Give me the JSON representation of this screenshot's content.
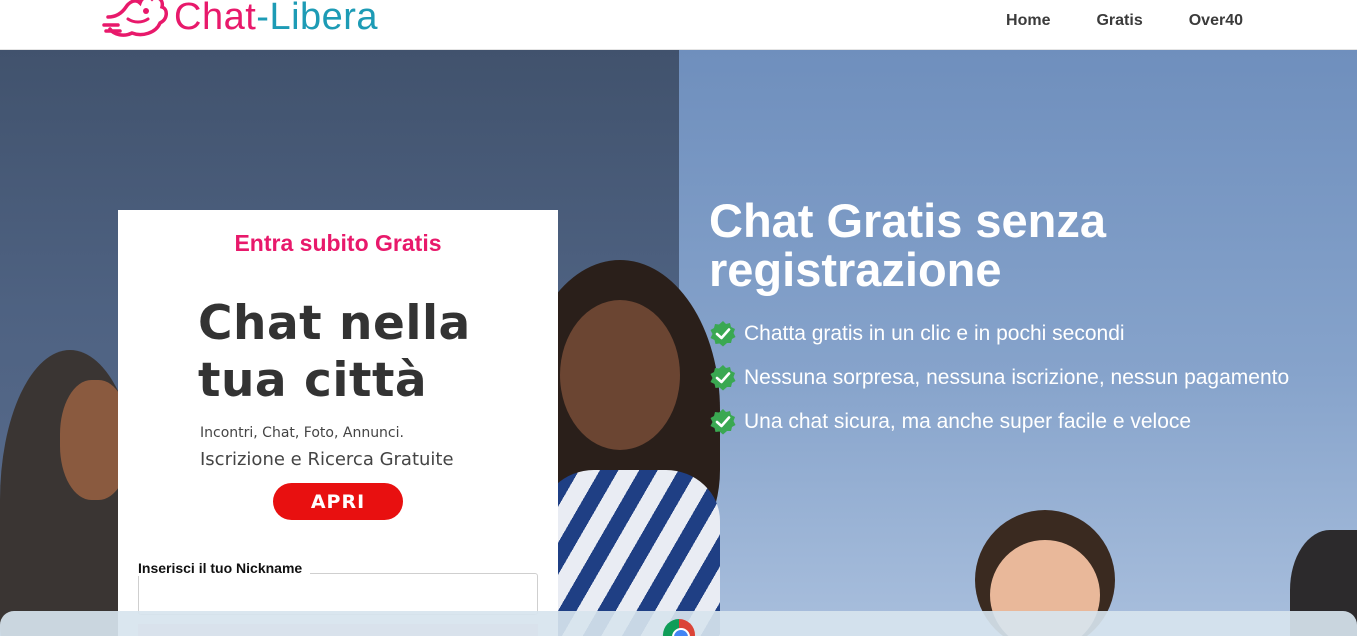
{
  "header": {
    "logo": {
      "part1": "Chat",
      "dash": "-",
      "part2": "Libera"
    },
    "nav": [
      "Home",
      "Gratis",
      "Over40"
    ],
    "colors": {
      "pink": "#e8196b",
      "teal": "#1d9bb5"
    }
  },
  "card": {
    "title": "Entra subito Gratis",
    "promo": {
      "line1": "Chat nella",
      "line2": "tua città",
      "sub1": "Incontri, Chat, Foto, Annunci.",
      "sub2": "Iscrizione e Ricerca Gratuite",
      "button": "APRI"
    },
    "nickname_label": "Inserisci il tuo Nickname",
    "nickname_value": "",
    "nickname_placeholder": ""
  },
  "hero": {
    "title": "Chat Gratis senza registrazione",
    "features": [
      "Chatta gratis in un clic e in pochi secondi",
      "Nessuna sorpresa, nessuna iscrizione, nessun pagamento",
      "Una chat sicura, ma anche super facile e veloce"
    ],
    "check_icon": "check-badge-icon",
    "check_color": "#3aa852"
  }
}
